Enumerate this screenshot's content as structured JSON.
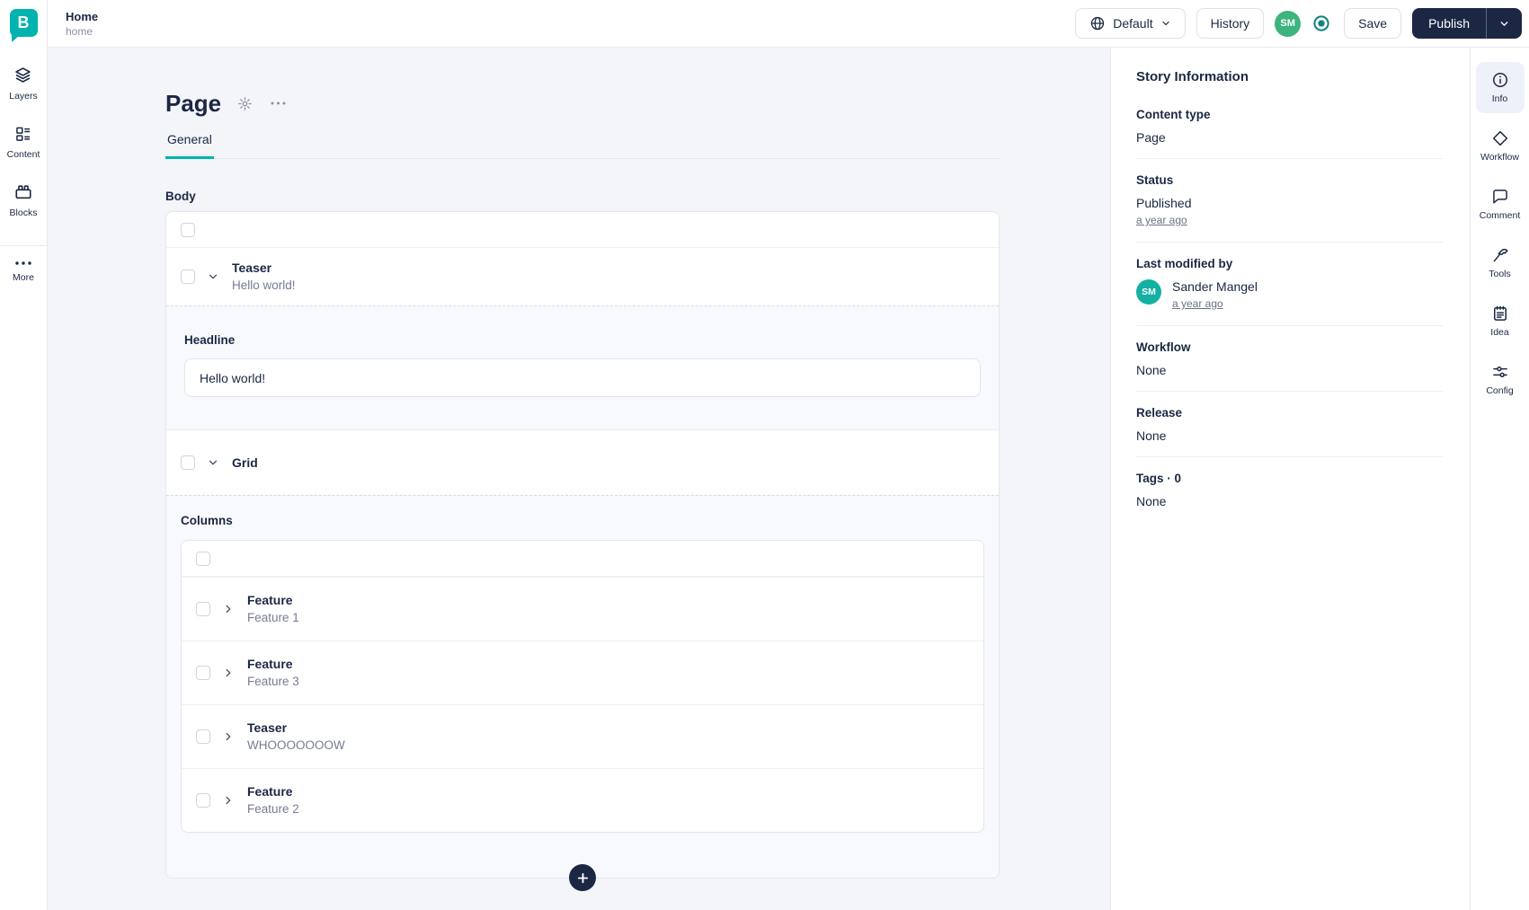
{
  "colors": {
    "accent_teal": "#00b3b0",
    "navy": "#1b2743",
    "avatar_green": "#3db47e",
    "avatar_teal": "#14b0a3",
    "record_teal": "#0d8280",
    "main_background": "#f4f5f9"
  },
  "topbar": {
    "story_title": "Home",
    "story_slug": "home",
    "language_label": "Default",
    "history_label": "History",
    "avatar_initials": "SM",
    "save_label": "Save",
    "publish_label": "Publish"
  },
  "sidebar": {
    "logo_letter": "B",
    "items": [
      {
        "label": "Layers",
        "icon": "layers-icon"
      },
      {
        "label": "Content",
        "icon": "content-icon"
      },
      {
        "label": "Blocks",
        "icon": "blocks-icon"
      },
      {
        "label": "More",
        "icon": "more-icon"
      }
    ]
  },
  "editor": {
    "page_title": "Page",
    "tabs": [
      {
        "label": "General",
        "active": true
      }
    ],
    "body_field": {
      "label": "Body",
      "teaser_block": {
        "name": "Teaser",
        "preview": "Hello world!"
      },
      "headline_field": {
        "label": "Headline",
        "value": "Hello world!"
      },
      "grid_block": {
        "name": "Grid"
      },
      "columns_field": {
        "label": "Columns",
        "blocks": [
          {
            "name": "Feature",
            "preview": "Feature 1"
          },
          {
            "name": "Feature",
            "preview": "Feature 3"
          },
          {
            "name": "Teaser",
            "preview": "WHOOOOOOOW"
          },
          {
            "name": "Feature",
            "preview": "Feature 2"
          }
        ]
      }
    }
  },
  "story_info": {
    "title": "Story Information",
    "content_type": {
      "label": "Content type",
      "value": "Page"
    },
    "status": {
      "label": "Status",
      "value": "Published",
      "time_link": "a year ago"
    },
    "last_modified": {
      "label": "Last modified by",
      "avatar_initials": "SM",
      "user": "Sander Mangel",
      "time_link": "a year ago"
    },
    "workflow": {
      "label": "Workflow",
      "value": "None"
    },
    "release": {
      "label": "Release",
      "value": "None"
    },
    "tags": {
      "label": "Tags · 0",
      "value": "None"
    }
  },
  "rightbar": {
    "items": [
      {
        "label": "Info",
        "icon": "info-icon",
        "active": true
      },
      {
        "label": "Workflow",
        "icon": "workflow-icon"
      },
      {
        "label": "Comment",
        "icon": "comment-icon"
      },
      {
        "label": "Tools",
        "icon": "tools-icon"
      },
      {
        "label": "Idea",
        "icon": "idea-icon"
      },
      {
        "label": "Config",
        "icon": "config-icon"
      }
    ]
  }
}
